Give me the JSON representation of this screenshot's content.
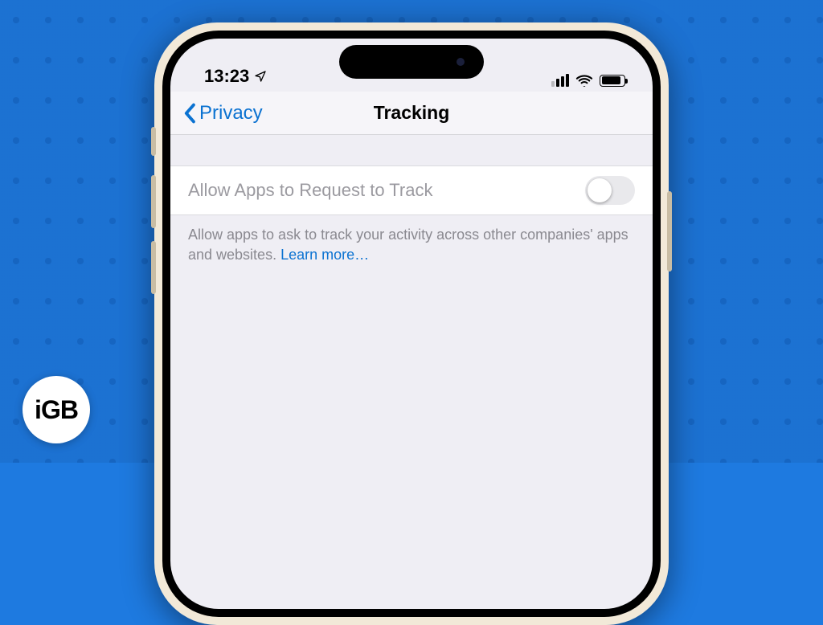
{
  "badge": {
    "text": "iGB"
  },
  "status": {
    "time": "13:23",
    "location_icon": "location-arrow-icon"
  },
  "nav": {
    "back_label": "Privacy",
    "title": "Tracking"
  },
  "setting": {
    "label": "Allow Apps to Request to Track",
    "toggle_on": false
  },
  "footer": {
    "text": "Allow apps to ask to track your activity across other companies' apps and websites. ",
    "link_label": "Learn more…"
  }
}
